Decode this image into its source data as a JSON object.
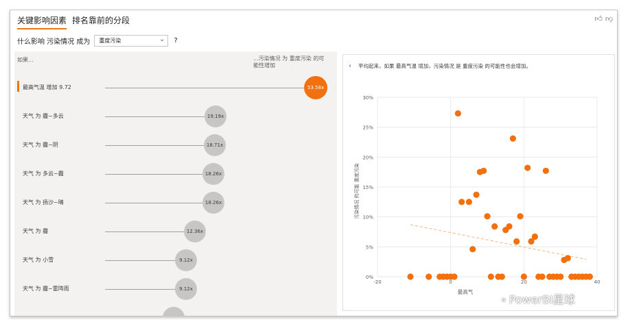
{
  "tabs": [
    "关键影响因素",
    "排名靠前的分段"
  ],
  "question": {
    "prefix": "什么影响 污染情况 成为",
    "selected": "重度污染",
    "help": "?"
  },
  "icons": {
    "like": "thumbs-up-icon",
    "dislike": "thumbs-down-icon",
    "back": "chevron-left-icon",
    "dropdown": "chevron-down-icon",
    "wechat": "wechat-icon"
  },
  "left": {
    "if_label": "如果...",
    "then_label": "...污染情况 为 重度污染 的可能性增加",
    "rows": [
      {
        "label": "最高气温 增加 9.72",
        "value": "53.58x",
        "selected": true
      },
      {
        "label": "天气 为 霾~多云",
        "value": "19.19x",
        "selected": false
      },
      {
        "label": "天气 为 霾~阴",
        "value": "18.71x",
        "selected": false
      },
      {
        "label": "天气 为 多云~霾",
        "value": "18.26x",
        "selected": false
      },
      {
        "label": "天气 为 扬沙~晴",
        "value": "18.26x",
        "selected": false
      },
      {
        "label": "天气 为 霾",
        "value": "12.36x",
        "selected": false
      },
      {
        "label": "天气 为 小雪",
        "value": "9.12x",
        "selected": false
      },
      {
        "label": "天气 为 霾~雷阵雨",
        "value": "9.12x",
        "selected": false
      },
      {
        "label": "",
        "value": "",
        "selected": false
      }
    ]
  },
  "right": {
    "back": "‹",
    "description": "平均起来，如果 最高气温 增加，污染情况 是 重度污染 的可能性也会增加。"
  },
  "chart_data": {
    "type": "scatter",
    "xlabel": "最高气",
    "ylabel": "污染情况 的可能 重度污染",
    "xlim": [
      -20,
      40
    ],
    "ylim": [
      0,
      30
    ],
    "x_ticks": [
      "-20",
      "0",
      "20",
      "40"
    ],
    "y_ticks": [
      "0%",
      "5%",
      "10%",
      "15%",
      "20%",
      "25%",
      "30%"
    ],
    "color": "#f2700e",
    "points": [
      [
        -11,
        0
      ],
      [
        -6,
        0
      ],
      [
        -3,
        0
      ],
      [
        -2,
        0
      ],
      [
        -1,
        0
      ],
      [
        0,
        0
      ],
      [
        1,
        0
      ],
      [
        2,
        27.3
      ],
      [
        3,
        12.5
      ],
      [
        5,
        12.5
      ],
      [
        6,
        4.6
      ],
      [
        7,
        13.7
      ],
      [
        8,
        17.5
      ],
      [
        9,
        17.7
      ],
      [
        10,
        10.1
      ],
      [
        11,
        0
      ],
      [
        12,
        8.4
      ],
      [
        13,
        0
      ],
      [
        14,
        0
      ],
      [
        15,
        7.8
      ],
      [
        16,
        8.4
      ],
      [
        17,
        23.1
      ],
      [
        18,
        5.9
      ],
      [
        19,
        10.1
      ],
      [
        20,
        0
      ],
      [
        21,
        18.2
      ],
      [
        22,
        5.9
      ],
      [
        23,
        6.7
      ],
      [
        24,
        0
      ],
      [
        25,
        0
      ],
      [
        26,
        17.7
      ],
      [
        27,
        0
      ],
      [
        28,
        0
      ],
      [
        29,
        0
      ],
      [
        30,
        0
      ],
      [
        31,
        2.8
      ],
      [
        32,
        3.1
      ],
      [
        33,
        0
      ],
      [
        34,
        0
      ],
      [
        35,
        0
      ],
      [
        36,
        0
      ],
      [
        37,
        0
      ],
      [
        38,
        0
      ]
    ],
    "trend": [
      [
        -11,
        8.7
      ],
      [
        37,
        2.9
      ]
    ],
    "trend_color": "#f2b37a"
  },
  "watermark": "PowerBI星球"
}
